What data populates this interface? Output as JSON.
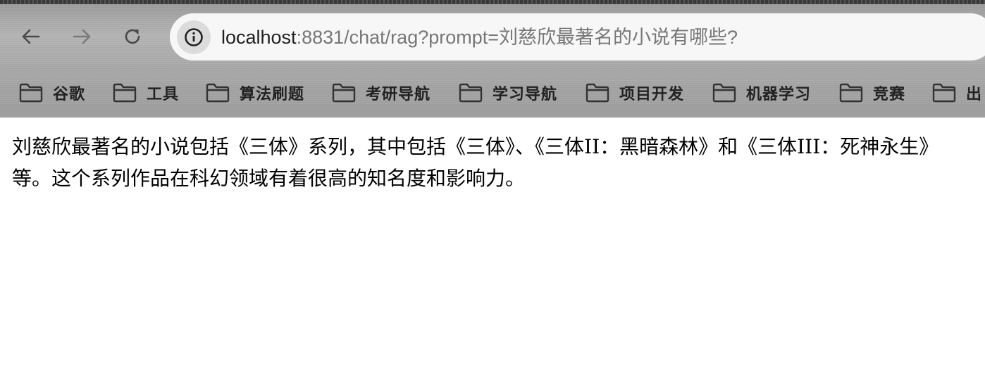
{
  "browser": {
    "url_host": "localhost",
    "url_rest": ":8831/chat/rag?prompt=刘慈欣最著名的小说有哪些?",
    "icons": {
      "back": "arrow-left-icon",
      "forward": "arrow-right-icon",
      "reload": "reload-icon",
      "site_info": "info-icon",
      "folder": "folder-icon"
    }
  },
  "bookmarks": [
    {
      "label": "谷歌"
    },
    {
      "label": "工具"
    },
    {
      "label": "算法刷题"
    },
    {
      "label": "考研导航"
    },
    {
      "label": "学习导航"
    },
    {
      "label": "项目开发"
    },
    {
      "label": "机器学习"
    },
    {
      "label": "竞赛"
    },
    {
      "label": "出"
    }
  ],
  "page": {
    "answer": "刘慈欣最著名的小说包括《三体》系列，其中包括《三体》、《三体II：黑暗森林》和《三体III：死神永生》等。这个系列作品在科幻领域有着很高的知名度和影响力。"
  }
}
